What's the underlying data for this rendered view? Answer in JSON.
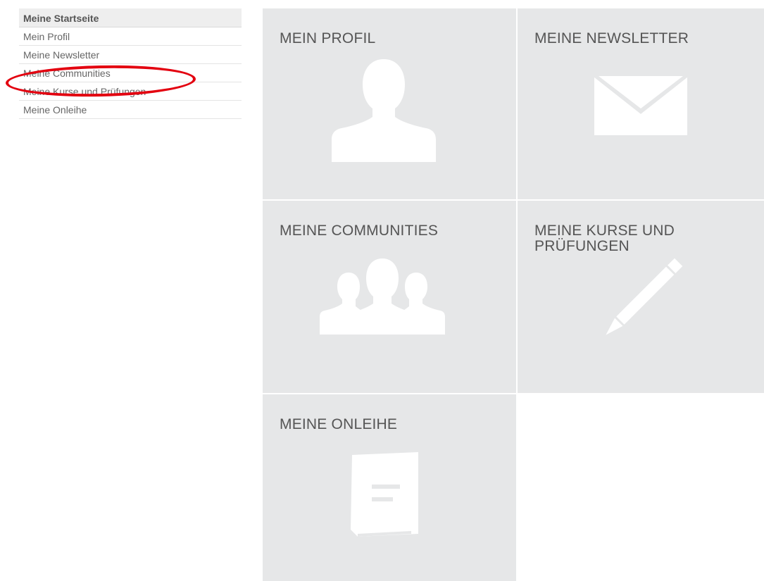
{
  "sidebar": {
    "heading": "Meine Startseite",
    "items": [
      {
        "label": "Mein Profil"
      },
      {
        "label": "Meine Newsletter"
      },
      {
        "label": "Meine Communities"
      },
      {
        "label": "Meine Kurse und Prüfungen"
      },
      {
        "label": "Meine Onleihe"
      }
    ]
  },
  "tiles": [
    {
      "title": "MEIN PROFIL",
      "icon": "person-icon"
    },
    {
      "title": "MEINE NEWSLETTER",
      "icon": "envelope-icon"
    },
    {
      "title": "MEINE COMMUNITIES",
      "icon": "group-icon"
    },
    {
      "title": "MEINE KURSE UND PRÜFUNGEN",
      "icon": "pencil-icon"
    },
    {
      "title": "MEINE ONLEIHE",
      "icon": "book-icon"
    }
  ],
  "colors": {
    "tile_background": "#e6e7e8",
    "icon_fill": "#ffffff",
    "annotation_ring": "#e3000f"
  }
}
